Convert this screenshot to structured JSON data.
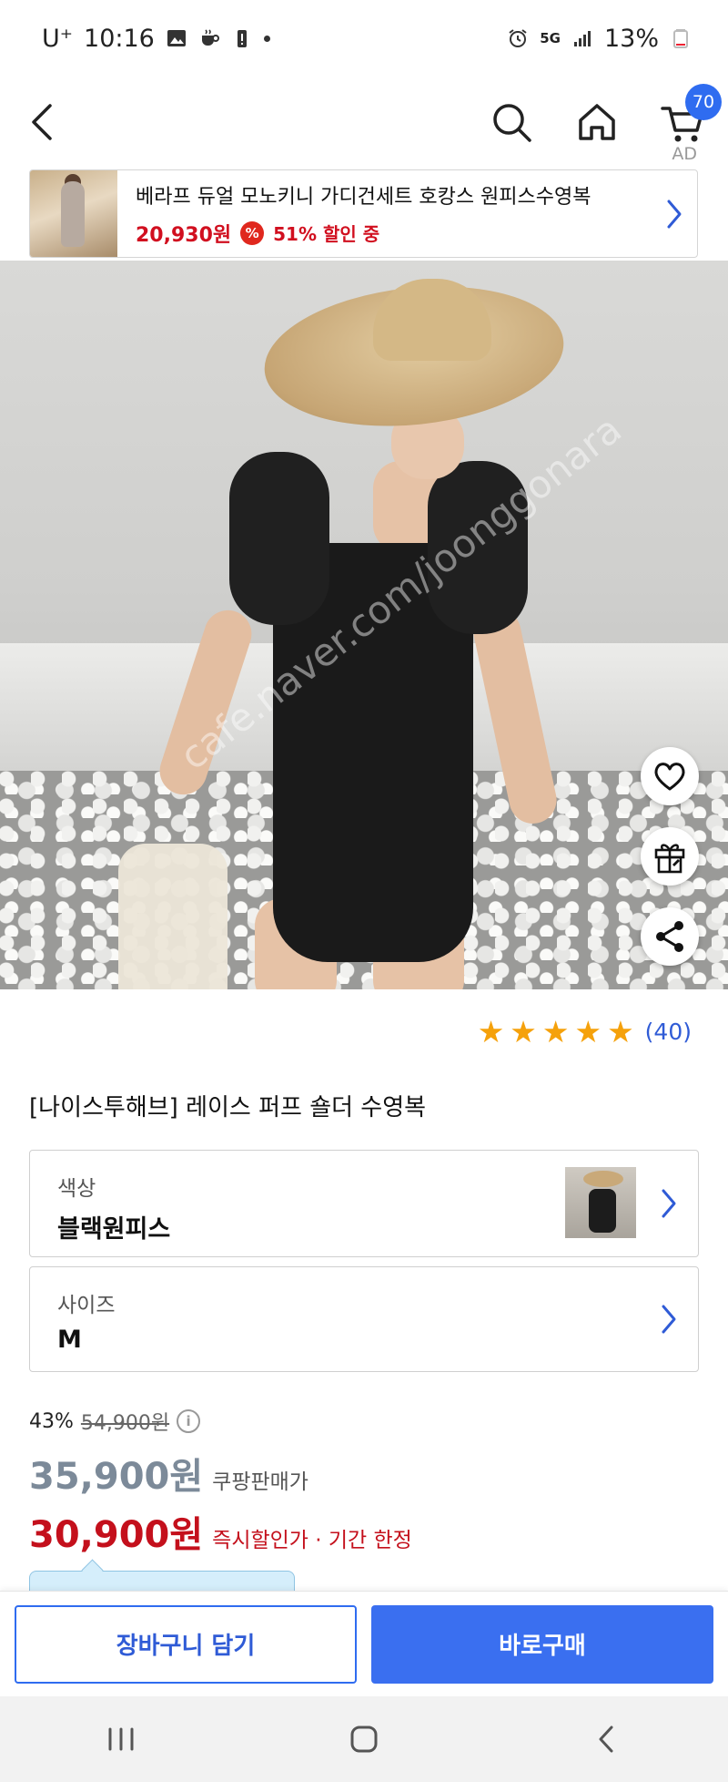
{
  "status_bar": {
    "carrier": "U⁺",
    "time": "10:16",
    "network": "5G",
    "battery": "13%"
  },
  "nav": {
    "cart_count": "70"
  },
  "ad": {
    "label": "AD",
    "title": "베라프 듀얼 모노키니 가디건세트 호캉스 원피스수영복",
    "price": "20,930원",
    "discount_badge": "%",
    "discount_text": "51% 할인 중"
  },
  "product": {
    "watermark": "cafe.naver.com/joonggonara",
    "rating_stars": 5,
    "review_count": "(40)",
    "title": "[나이스투해브] 레이스 퍼프 숄더 수영복"
  },
  "options": {
    "color": {
      "label": "색상",
      "value": "블랙원피스"
    },
    "size": {
      "label": "사이즈",
      "value": "M"
    }
  },
  "pricing": {
    "discount_rate": "43%",
    "original_price": "54,900원",
    "info_icon": "i",
    "coupang_price": "35,900원",
    "coupang_price_label": "쿠팡판매가",
    "instant_price": "30,900원",
    "instant_price_label": "즉시할인가 · 기간 한정",
    "colors": {
      "coupang": "#7c8a99",
      "instant": "#c4101c"
    }
  },
  "actions": {
    "cart_button": "장바구니 담기",
    "buy_button": "바로구매"
  },
  "icons": [
    "back-icon",
    "search-icon",
    "home-icon",
    "cart-icon",
    "heart-icon",
    "gift-icon",
    "share-icon",
    "star-icon",
    "info-icon",
    "chevron-right-icon",
    "recents-icon",
    "home-button-icon",
    "back-nav-icon"
  ]
}
